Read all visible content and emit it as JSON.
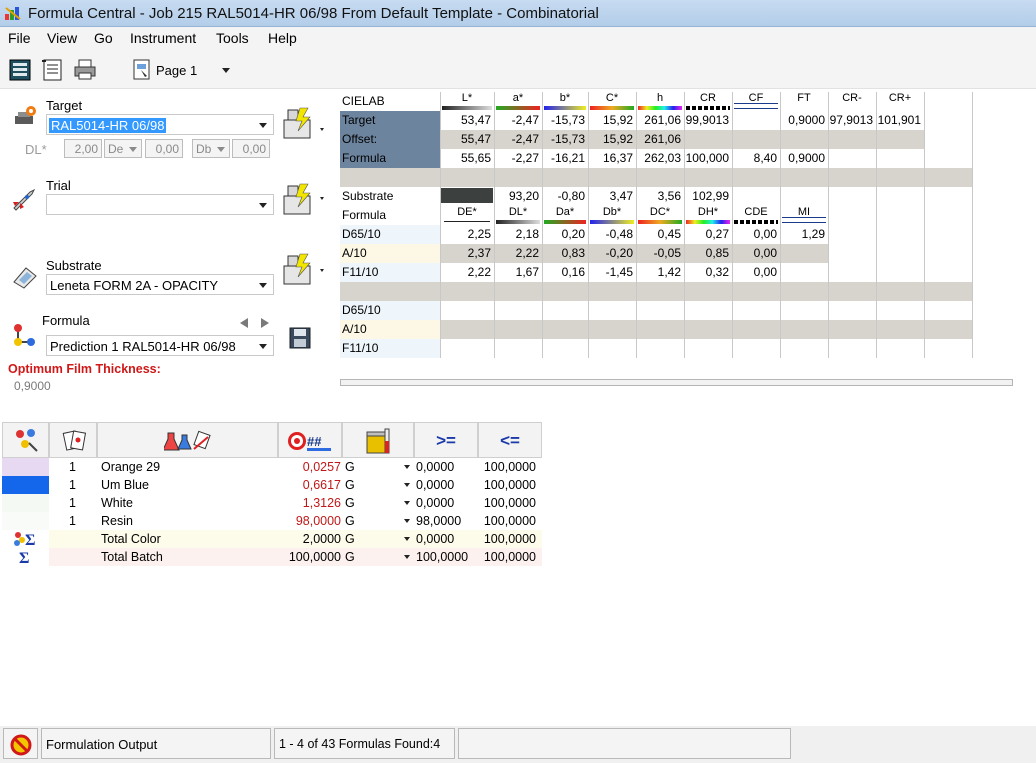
{
  "window": {
    "title": "Formula Central  -  Job 215 RAL5014-HR 06/98 From Default Template  -  Combinatorial"
  },
  "menu": [
    "File",
    "View",
    "Go",
    "Instrument",
    "Tools",
    "Help"
  ],
  "toolbar": {
    "page_label": "Page 1"
  },
  "left": {
    "target_label": "Target",
    "target_value": "RAL5014-HR 06/98",
    "dl_label": "DL*",
    "dl_value": "2,00",
    "de_combo": "De",
    "de_value": "0,00",
    "db_combo": "Db",
    "db_value": "0,00",
    "trial_label": "Trial",
    "trial_value": "",
    "substrate_label": "Substrate",
    "substrate_value": "Leneta FORM 2A - OPACITY",
    "formula_label": "Formula",
    "formula_value": "Prediction 1 RAL5014-HR 06/98",
    "oft_label": "Optimum Film Thickness:",
    "oft_value": "0,9000"
  },
  "cielab": {
    "header_label": "CIELAB",
    "columns": [
      "L*",
      "a*",
      "b*",
      "C*",
      "h",
      "CR",
      "CF",
      "FT",
      "CR-",
      "CR+"
    ],
    "rows": [
      {
        "label": "Target",
        "values": [
          "53,47",
          "-2,47",
          "-15,73",
          "15,92",
          "261,06",
          "99,9013",
          "",
          "0,9000",
          "97,9013",
          "101,901"
        ]
      },
      {
        "label": "Offset:",
        "values": [
          "55,47",
          "-2,47",
          "-15,73",
          "15,92",
          "261,06",
          "",
          "",
          "",
          "",
          ""
        ]
      },
      {
        "label": "Formula",
        "values": [
          "55,65",
          "-2,27",
          "-16,21",
          "16,37",
          "262,03",
          "100,000",
          "8,40",
          "0,9000",
          "",
          ""
        ]
      }
    ],
    "substrate_row": {
      "label": "Substrate",
      "values": [
        "93,20",
        "-0,80",
        "3,47",
        "3,56",
        "102,99"
      ]
    },
    "diff_header_label": "Formula",
    "diff_columns": [
      "DE*",
      "DL*",
      "Da*",
      "Db*",
      "DC*",
      "DH*",
      "CDE",
      "MI"
    ],
    "diff_rows": [
      {
        "label": "D65/10",
        "values": [
          "2,25",
          "2,18",
          "0,20",
          "-0,48",
          "0,45",
          "0,27",
          "0,00",
          "1,29"
        ]
      },
      {
        "label": "A/10",
        "values": [
          "2,37",
          "2,22",
          "0,83",
          "-0,20",
          "-0,05",
          "0,85",
          "0,00",
          ""
        ]
      },
      {
        "label": "F11/10",
        "values": [
          "2,22",
          "1,67",
          "0,16",
          "-1,45",
          "1,42",
          "0,32",
          "0,00",
          ""
        ]
      }
    ],
    "illum_rows": [
      "D65/10",
      "A/10",
      "F11/10"
    ]
  },
  "ingredients": {
    "header_min": ">=",
    "header_max": "<=",
    "rows": [
      {
        "qty": "1",
        "name": "Orange 29",
        "amount": "0,0257",
        "unit": "G",
        "min": "0,0000",
        "max": "100,0000",
        "color": "#e8d9f3",
        "red": true
      },
      {
        "qty": "1",
        "name": "Um Blue",
        "amount": "0,6617",
        "unit": "G",
        "min": "0,0000",
        "max": "100,0000",
        "color": "#1467ea",
        "red": true
      },
      {
        "qty": "1",
        "name": "White",
        "amount": "1,3126",
        "unit": "G",
        "min": "0,0000",
        "max": "100,0000",
        "color": "#f4f9f4",
        "red": true
      },
      {
        "qty": "1",
        "name": "Resin",
        "amount": "98,0000",
        "unit": "G",
        "min": "98,0000",
        "max": "100,0000",
        "color": "#f8fbf8",
        "red": true
      }
    ],
    "totals": [
      {
        "name": "Total Color",
        "amount": "2,0000",
        "unit": "G",
        "min": "0,0000",
        "max": "100,0000"
      },
      {
        "name": "Total Batch",
        "amount": "100,0000",
        "unit": "G",
        "min": "100,0000",
        "max": "100,0000"
      }
    ]
  },
  "status": {
    "output": "Formulation Output",
    "found": "1 - 4 of 43  Formulas Found:4",
    "extra": ""
  }
}
